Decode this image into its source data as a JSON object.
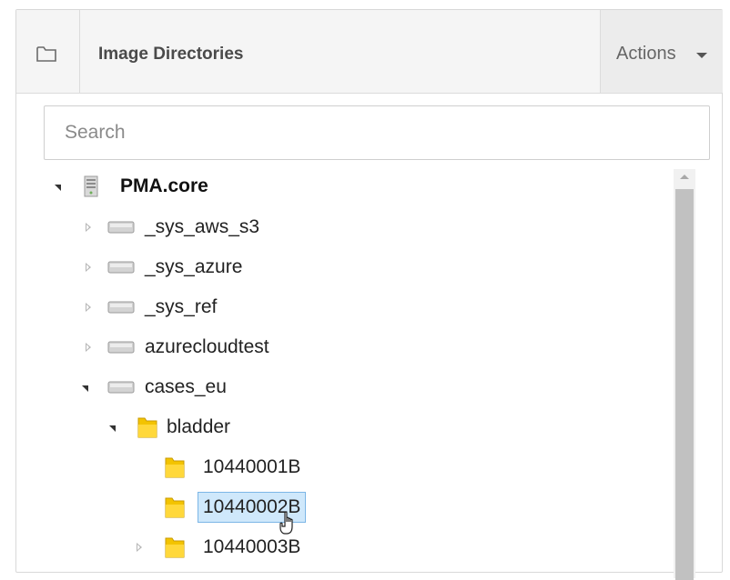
{
  "header": {
    "title": "Image Directories",
    "folder_icon": "folder-outline-icon",
    "actions_label": "Actions",
    "actions_caret_icon": "caret-down-icon"
  },
  "search": {
    "value": "",
    "placeholder": "Search"
  },
  "tree": {
    "root": {
      "label": "PMA.core",
      "icon": "server-icon",
      "expanded": true
    },
    "items": [
      {
        "label": "_sys_aws_s3",
        "icon": "drive-icon",
        "expanded": false
      },
      {
        "label": "_sys_azure",
        "icon": "drive-icon",
        "expanded": false
      },
      {
        "label": "_sys_ref",
        "icon": "drive-icon",
        "expanded": false
      },
      {
        "label": "azurecloudtest",
        "icon": "drive-icon",
        "expanded": false
      },
      {
        "label": "cases_eu",
        "icon": "drive-icon",
        "expanded": true
      },
      {
        "label": "bladder",
        "icon": "folder-icon",
        "expanded": true
      },
      {
        "label": "10440001B",
        "icon": "folder-icon"
      },
      {
        "label": "10440002B",
        "icon": "folder-icon",
        "selected": true
      },
      {
        "label": "104400",
        "icon": "folder-icon",
        "expanded": false,
        "clipped_suffix": "03B"
      }
    ]
  },
  "colors": {
    "header_bg": "#f5f5f5",
    "selection_bg": "#cfe8fb",
    "selection_border": "#7cb6e6",
    "folder_yellow": "#f3c300"
  }
}
